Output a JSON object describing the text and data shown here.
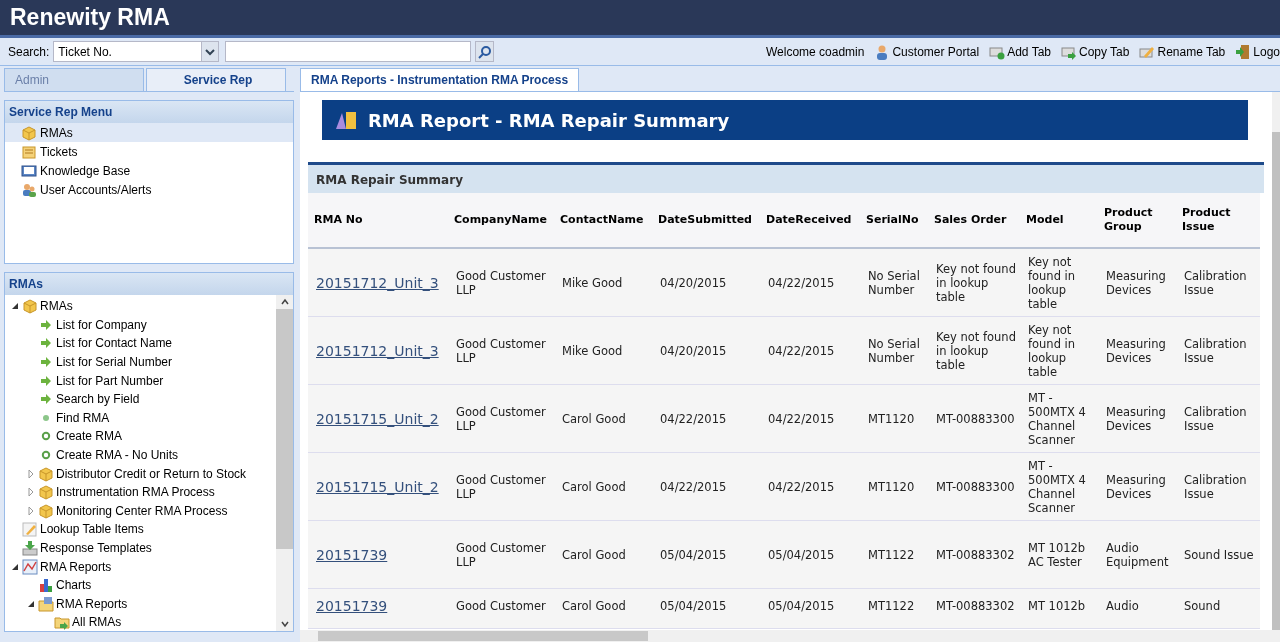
{
  "app_title": "Renewity RMA",
  "search": {
    "label": "Search:",
    "field_value": "Ticket No."
  },
  "welcome": "Welcome coadmin",
  "toolbar": [
    {
      "label": "Customer Portal",
      "kind": "user"
    },
    {
      "label": "Add Tab",
      "kind": "add"
    },
    {
      "label": "Copy Tab",
      "kind": "copy"
    },
    {
      "label": "Rename Tab",
      "kind": "rename"
    },
    {
      "label": "Logo",
      "kind": "logout"
    }
  ],
  "side_tabs": [
    {
      "label": "Admin",
      "selected": false
    },
    {
      "label": "Service Rep",
      "selected": true
    }
  ],
  "menu": {
    "title": "Service Rep Menu",
    "items": [
      {
        "label": "RMAs",
        "kind": "box",
        "selected": true
      },
      {
        "label": "Tickets",
        "kind": "ticket",
        "selected": false
      },
      {
        "label": "Knowledge Base",
        "kind": "book",
        "selected": false
      },
      {
        "label": "User Accounts/Alerts",
        "kind": "users",
        "selected": false
      }
    ]
  },
  "tree": {
    "title": "RMAs",
    "items": [
      {
        "label": "RMAs",
        "kind": "box",
        "expanded": true,
        "children": [
          {
            "label": "List for Company",
            "kind": "arrow"
          },
          {
            "label": "List for Contact Name",
            "kind": "arrow"
          },
          {
            "label": "List for Serial Number",
            "kind": "arrow"
          },
          {
            "label": "List for Part Number",
            "kind": "arrow"
          },
          {
            "label": "Search by Field",
            "kind": "arrow"
          },
          {
            "label": "Find RMA",
            "kind": "dot"
          },
          {
            "label": "Create RMA",
            "kind": "ring"
          },
          {
            "label": "Create RMA - No Units",
            "kind": "ring"
          },
          {
            "label": "Distributor Credit or Return to Stock",
            "kind": "box",
            "expanded": false
          },
          {
            "label": "Instrumentation RMA Process",
            "kind": "box",
            "expanded": false
          },
          {
            "label": "Monitoring Center RMA Process",
            "kind": "box",
            "expanded": false
          }
        ]
      },
      {
        "label": "Lookup Table Items",
        "kind": "pencil"
      },
      {
        "label": "Response Templates",
        "kind": "tray"
      },
      {
        "label": "RMA Reports",
        "kind": "report",
        "expanded": true,
        "children": [
          {
            "label": "Charts",
            "kind": "chart"
          },
          {
            "label": "RMA Reports",
            "kind": "folder",
            "expanded": true,
            "children": [
              {
                "label": "All RMAs",
                "kind": "folder-arrow"
              }
            ]
          }
        ]
      }
    ]
  },
  "main_tabs": [
    {
      "label": "RMA Reports - Instrumentation RMA Process",
      "selected": true
    }
  ],
  "report_title": "RMA Report - RMA Repair Summary",
  "section_title": "RMA Repair Summary",
  "table": {
    "columns": [
      "RMA No",
      "CompanyName",
      "ContactName",
      "DateSubmitted",
      "DateReceived",
      "SerialNo",
      "Sales Order",
      "Model",
      "Product Group",
      "Product Issue"
    ],
    "rows": [
      [
        "20151712_Unit_3",
        "Good Customer LLP",
        "Mike Good",
        "04/20/2015",
        "04/22/2015",
        "No Serial Number",
        "Key not found in lookup table",
        "Key not found in lookup table",
        "Measuring Devices",
        "Calibration Issue"
      ],
      [
        "20151712_Unit_3",
        "Good Customer LLP",
        "Mike Good",
        "04/20/2015",
        "04/22/2015",
        "No Serial Number",
        "Key not found in lookup table",
        "Key not found in lookup table",
        "Measuring Devices",
        "Calibration Issue"
      ],
      [
        "20151715_Unit_2",
        "Good Customer LLP",
        "Carol Good",
        "04/22/2015",
        "04/22/2015",
        "MT1120",
        "MT-00883300",
        "MT - 500MTX 4 Channel Scanner",
        "Measuring Devices",
        "Calibration Issue"
      ],
      [
        "20151715_Unit_2",
        "Good Customer LLP",
        "Carol Good",
        "04/22/2015",
        "04/22/2015",
        "MT1120",
        "MT-00883300",
        "MT - 500MTX 4 Channel Scanner",
        "Measuring Devices",
        "Calibration Issue"
      ],
      [
        "20151739",
        "Good Customer LLP",
        "Carol Good",
        "05/04/2015",
        "05/04/2015",
        "MT1122",
        "MT-00883302",
        "MT 1012b AC Tester",
        "Audio Equipment",
        "Sound Issue"
      ],
      [
        "20151739",
        "Good Customer",
        "Carol Good",
        "05/04/2015",
        "05/04/2015",
        "MT1122",
        "MT-00883302",
        "MT 1012b",
        "Audio",
        "Sound"
      ]
    ]
  }
}
